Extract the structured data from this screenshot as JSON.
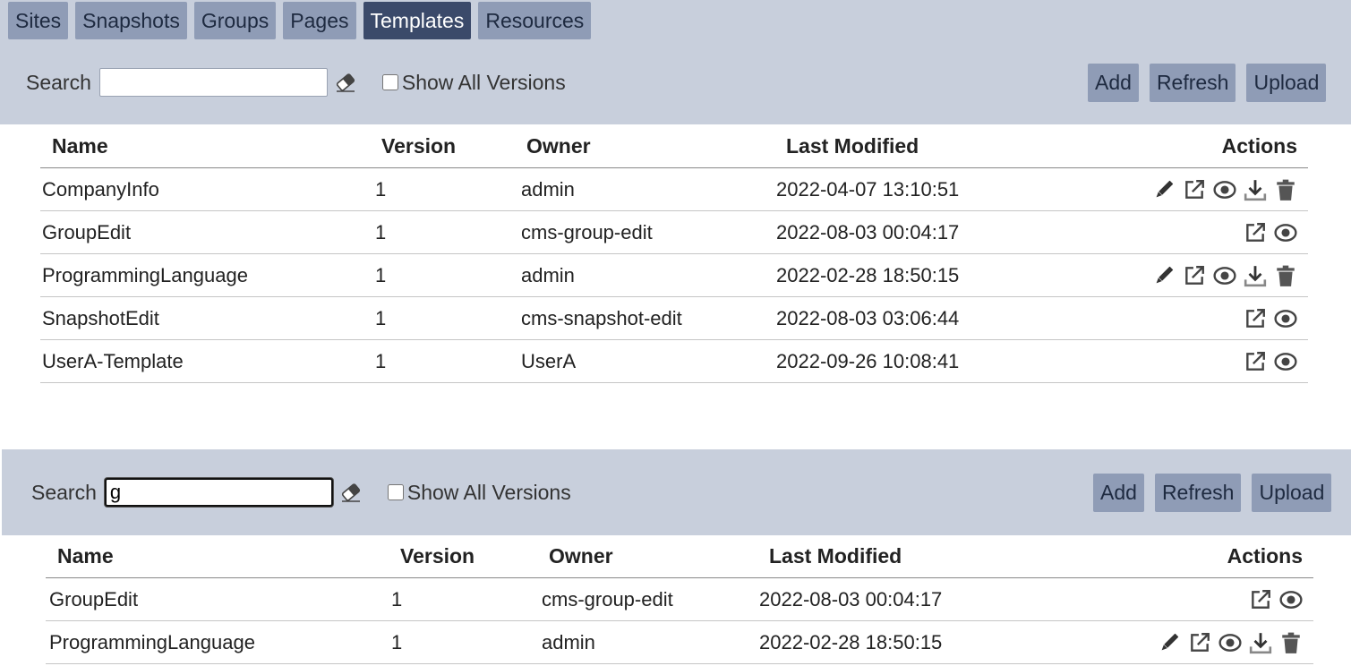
{
  "tabs": [
    "Sites",
    "Snapshots",
    "Groups",
    "Pages",
    "Templates",
    "Resources"
  ],
  "active_tab": "Templates",
  "toolbar": {
    "search_label": "Search",
    "show_all_label": "Show All Versions",
    "add_label": "Add",
    "refresh_label": "Refresh",
    "upload_label": "Upload"
  },
  "columns": {
    "name": "Name",
    "version": "Version",
    "owner": "Owner",
    "last_modified": "Last Modified",
    "actions": "Actions"
  },
  "panel_a": {
    "search_value": "",
    "rows": [
      {
        "name": "CompanyInfo",
        "version": "1",
        "owner": "admin",
        "modified": "2022-04-07 13:10:51",
        "actions": [
          "edit",
          "open",
          "view",
          "download",
          "delete"
        ]
      },
      {
        "name": "GroupEdit",
        "version": "1",
        "owner": "cms-group-edit",
        "modified": "2022-08-03 00:04:17",
        "actions": [
          "open",
          "view"
        ]
      },
      {
        "name": "ProgrammingLanguage",
        "version": "1",
        "owner": "admin",
        "modified": "2022-02-28 18:50:15",
        "actions": [
          "edit",
          "open",
          "view",
          "download",
          "delete"
        ]
      },
      {
        "name": "SnapshotEdit",
        "version": "1",
        "owner": "cms-snapshot-edit",
        "modified": "2022-08-03 03:06:44",
        "actions": [
          "open",
          "view"
        ]
      },
      {
        "name": "UserA-Template",
        "version": "1",
        "owner": "UserA",
        "modified": "2022-09-26 10:08:41",
        "actions": [
          "open",
          "view"
        ]
      }
    ]
  },
  "panel_b": {
    "search_value": "g",
    "rows": [
      {
        "name": "GroupEdit",
        "version": "1",
        "owner": "cms-group-edit",
        "modified": "2022-08-03 00:04:17",
        "actions": [
          "open",
          "view"
        ]
      },
      {
        "name": "ProgrammingLanguage",
        "version": "1",
        "owner": "admin",
        "modified": "2022-02-28 18:50:15",
        "actions": [
          "edit",
          "open",
          "view",
          "download",
          "delete"
        ]
      }
    ]
  },
  "icons": {
    "edit": "pencil-icon",
    "open": "external-link-icon",
    "view": "eye-icon",
    "download": "download-icon",
    "delete": "trash-icon",
    "clear": "eraser-icon"
  },
  "colors": {
    "header_bg": "#c8cfdc",
    "tab_bg": "#8f9cb6",
    "tab_active_bg": "#3b4a6a"
  }
}
